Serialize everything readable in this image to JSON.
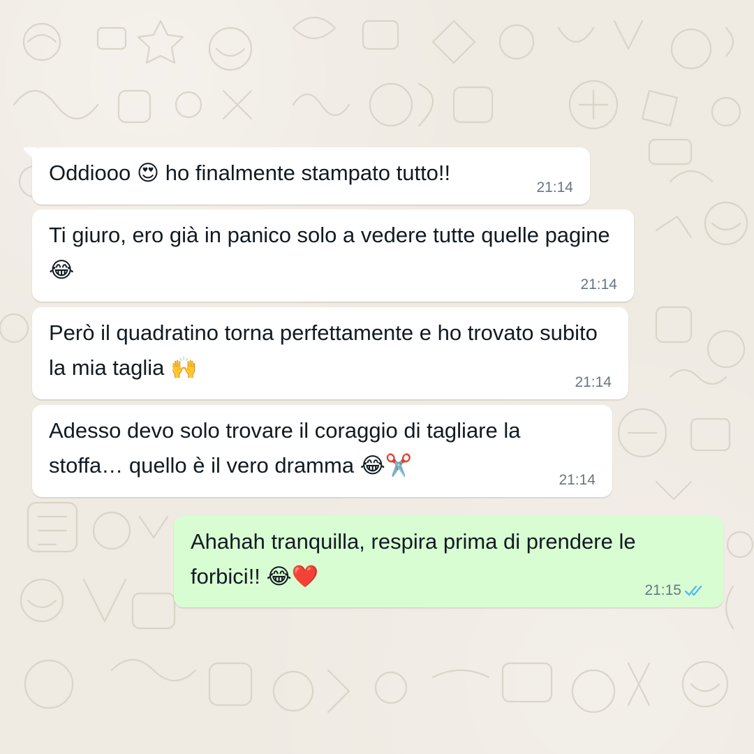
{
  "chat": {
    "messages": [
      {
        "direction": "incoming",
        "text": "Oddiooo 😍 ho finalmente stampato tutto!!",
        "time": "21:14"
      },
      {
        "direction": "incoming",
        "text": "Ti giuro, ero già in panico solo a vedere tutte quelle pagine 😂",
        "time": "21:14"
      },
      {
        "direction": "incoming",
        "text": "Però il quadratino torna perfettamente e ho trovato subito la mia taglia 🙌",
        "time": "21:14"
      },
      {
        "direction": "incoming",
        "text": "Adesso devo solo trovare il coraggio di tagliare la stoffa… quello è il vero dramma 😂✂️",
        "time": "21:14"
      },
      {
        "direction": "outgoing",
        "text": "Ahahah tranquilla, respira prima di prendere le forbici!! 😂❤️",
        "time": "21:15",
        "status_icon": "double-check-read-icon"
      }
    ]
  },
  "colors": {
    "wallpaper": "#efeae2",
    "incoming_bubble": "#ffffff",
    "outgoing_bubble": "#d9fdd3",
    "timestamp": "#667781",
    "read_ticks": "#53bdeb"
  }
}
